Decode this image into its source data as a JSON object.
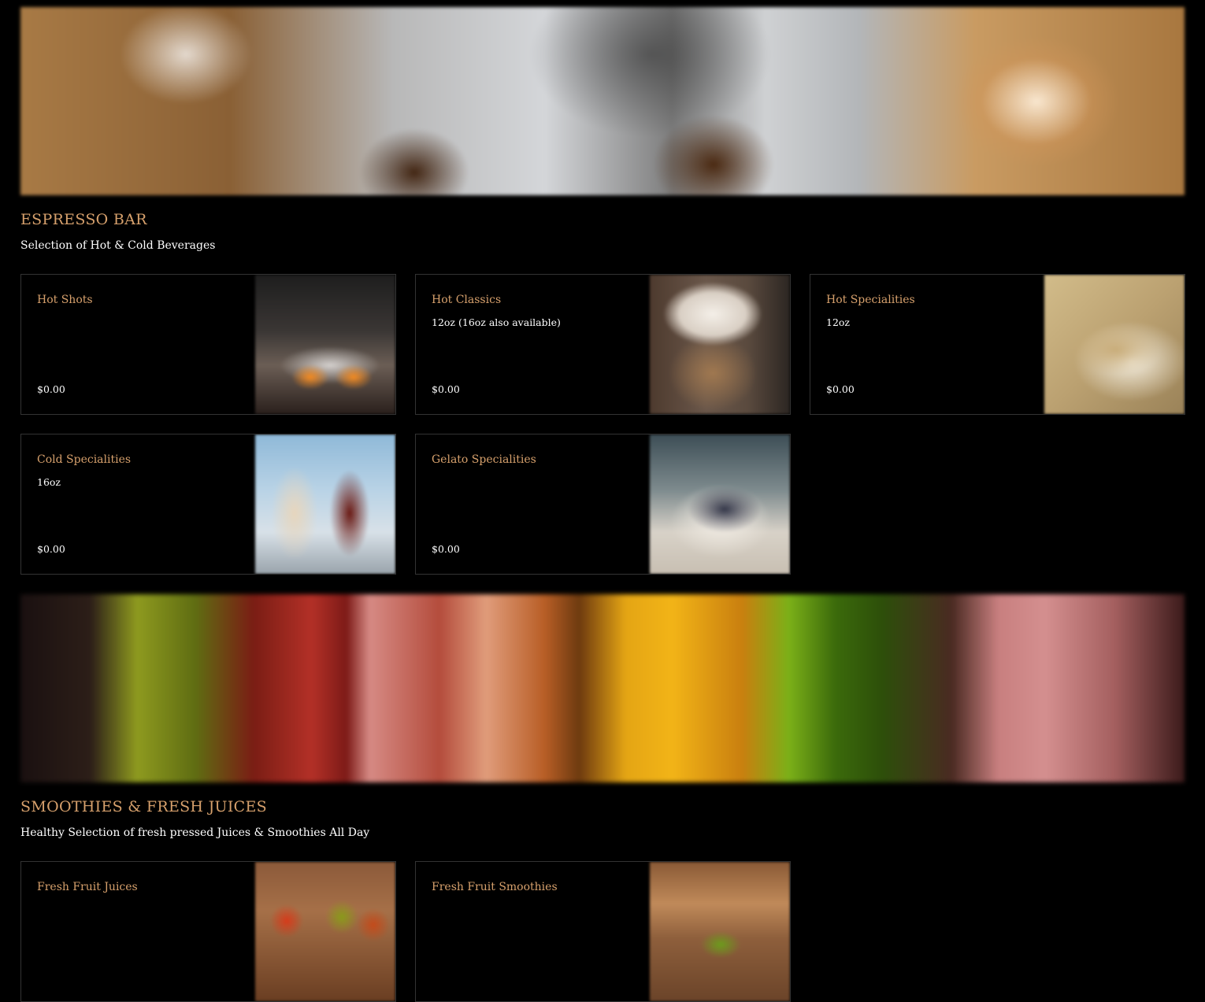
{
  "sections": [
    {
      "title": "ESPRESSO BAR",
      "subtitle": "Selection of Hot & Cold Beverages",
      "banner": "coffee-banner",
      "items": [
        {
          "name": "Hot Shots",
          "description": "",
          "price": "$0.00",
          "image": "hot-shots-photo"
        },
        {
          "name": "Hot Classics",
          "description": "12oz (16oz also available)",
          "price": "$0.00",
          "image": "hot-classics-photo"
        },
        {
          "name": "Hot Specialities",
          "description": "12oz",
          "price": "$0.00",
          "image": "hot-specialities-photo"
        },
        {
          "name": "Cold Specialities",
          "description": "16oz",
          "price": "$0.00",
          "image": "cold-specialities-photo"
        },
        {
          "name": "Gelato Specialities",
          "description": "",
          "price": "$0.00",
          "image": "gelato-specialities-photo"
        }
      ]
    },
    {
      "title": "SMOOTHIES & FRESH JUICES",
      "subtitle": "Healthy Selection of fresh pressed Juices & Smoothies All Day",
      "banner": "juice-banner",
      "items": [
        {
          "name": "Fresh Fruit Juices",
          "description": "",
          "price": "",
          "image": "fresh-fruit-juices-photo"
        },
        {
          "name": "Fresh Fruit Smoothies",
          "description": "",
          "price": "",
          "image": "fresh-fruit-smoothies-photo"
        }
      ]
    }
  ],
  "colors": {
    "background": "#000000",
    "accent": "#d6a06c",
    "text": "#ffffff",
    "card_border": "#333333"
  }
}
